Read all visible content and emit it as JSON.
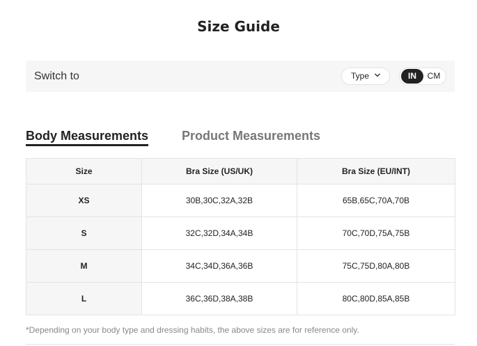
{
  "page": {
    "title": "Size Guide"
  },
  "switch_bar": {
    "label": "Switch to",
    "type_select": "Type",
    "units": [
      "IN",
      "CM"
    ],
    "selected_unit": "IN"
  },
  "tabs": [
    {
      "label": "Body Measurements",
      "active": true
    },
    {
      "label": "Product Measurements",
      "active": false
    }
  ],
  "table": {
    "headers": [
      "Size",
      "Bra Size (US/UK)",
      "Bra Size (EU/INT)"
    ],
    "rows": [
      [
        "XS",
        "30B,30C,32A,32B",
        "65B,65C,70A,70B"
      ],
      [
        "S",
        "32C,32D,34A,34B",
        "70C,70D,75A,75B"
      ],
      [
        "M",
        "34C,34D,36A,36B",
        "75C,75D,80A,80B"
      ],
      [
        "L",
        "36C,36D,38A,38B",
        "80C,80D,85A,85B"
      ]
    ]
  },
  "footnote": "*Depending on your body type and dressing habits, the above sizes are for reference only.",
  "colors": {
    "accent": "#222222",
    "panel_bg": "#f6f6f6",
    "border": "#e3e3e3",
    "inactive_tab": "#777777"
  },
  "icons": {
    "type_dropdown": "chevron-down-icon"
  }
}
